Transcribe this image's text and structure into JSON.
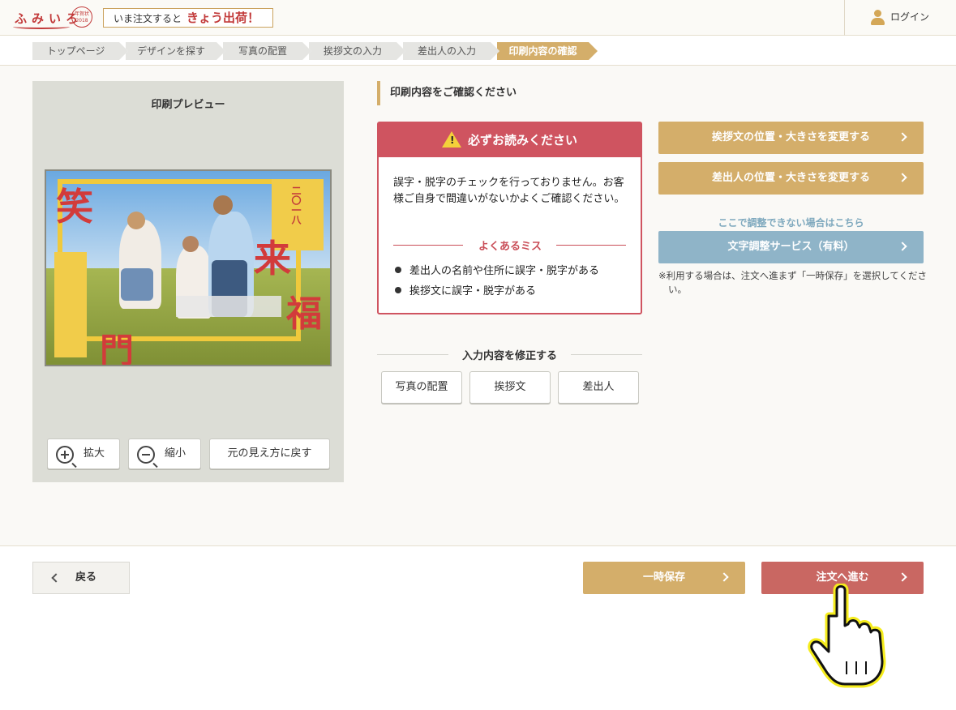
{
  "header": {
    "logo_text": "ふみいろ",
    "logo_badge": "年賀状 2018",
    "ship_prefix": "いま注文すると",
    "ship_highlight": "きょう出荷！",
    "login_label": "ログイン"
  },
  "breadcrumb": [
    {
      "label": "トップページ"
    },
    {
      "label": "デザインを探す"
    },
    {
      "label": "写真の配置"
    },
    {
      "label": "挨拶文の入力"
    },
    {
      "label": "差出人の入力"
    },
    {
      "label": "印刷内容の確認"
    }
  ],
  "preview": {
    "title": "印刷プレビュー",
    "card_kanji": [
      "笑",
      "門",
      "来",
      "福"
    ],
    "card_year": "二〇一八",
    "zoom_in": "拡大",
    "zoom_out": "縮小",
    "reset": "元の見え方に戻す"
  },
  "main": {
    "heading": "印刷内容をご確認ください",
    "warning": {
      "title": "必ずお読みください",
      "body": "誤字・脱字のチェックを行っておりません。お客様ご自身で間違いがないかよくご確認ください。",
      "mistakes_title": "よくあるミス",
      "mistakes": [
        "差出人の名前や住所に誤字・脱字がある",
        "挨拶文に誤字・脱字がある"
      ]
    },
    "fix_title": "入力内容を修正する",
    "fix_buttons": [
      "写真の配置",
      "挨拶文",
      "差出人"
    ]
  },
  "side": {
    "greeting_adjust": "挨拶文の位置・大きさを変更する",
    "sender_adjust": "差出人の位置・大きさを変更する",
    "adjust_note": "ここで調整できない場合はこちら",
    "text_service": "文字調整サービス（有料）",
    "service_note": "※利用する場合は、注文へ進まず「一時保存」を選択してください。"
  },
  "footer": {
    "back": "戻る",
    "save": "一時保存",
    "order": "注文へ進む"
  },
  "colors": {
    "gold": "#d4ae6a",
    "red": "#cf5460",
    "blue": "#8fb4c8",
    "order": "#c96762"
  }
}
